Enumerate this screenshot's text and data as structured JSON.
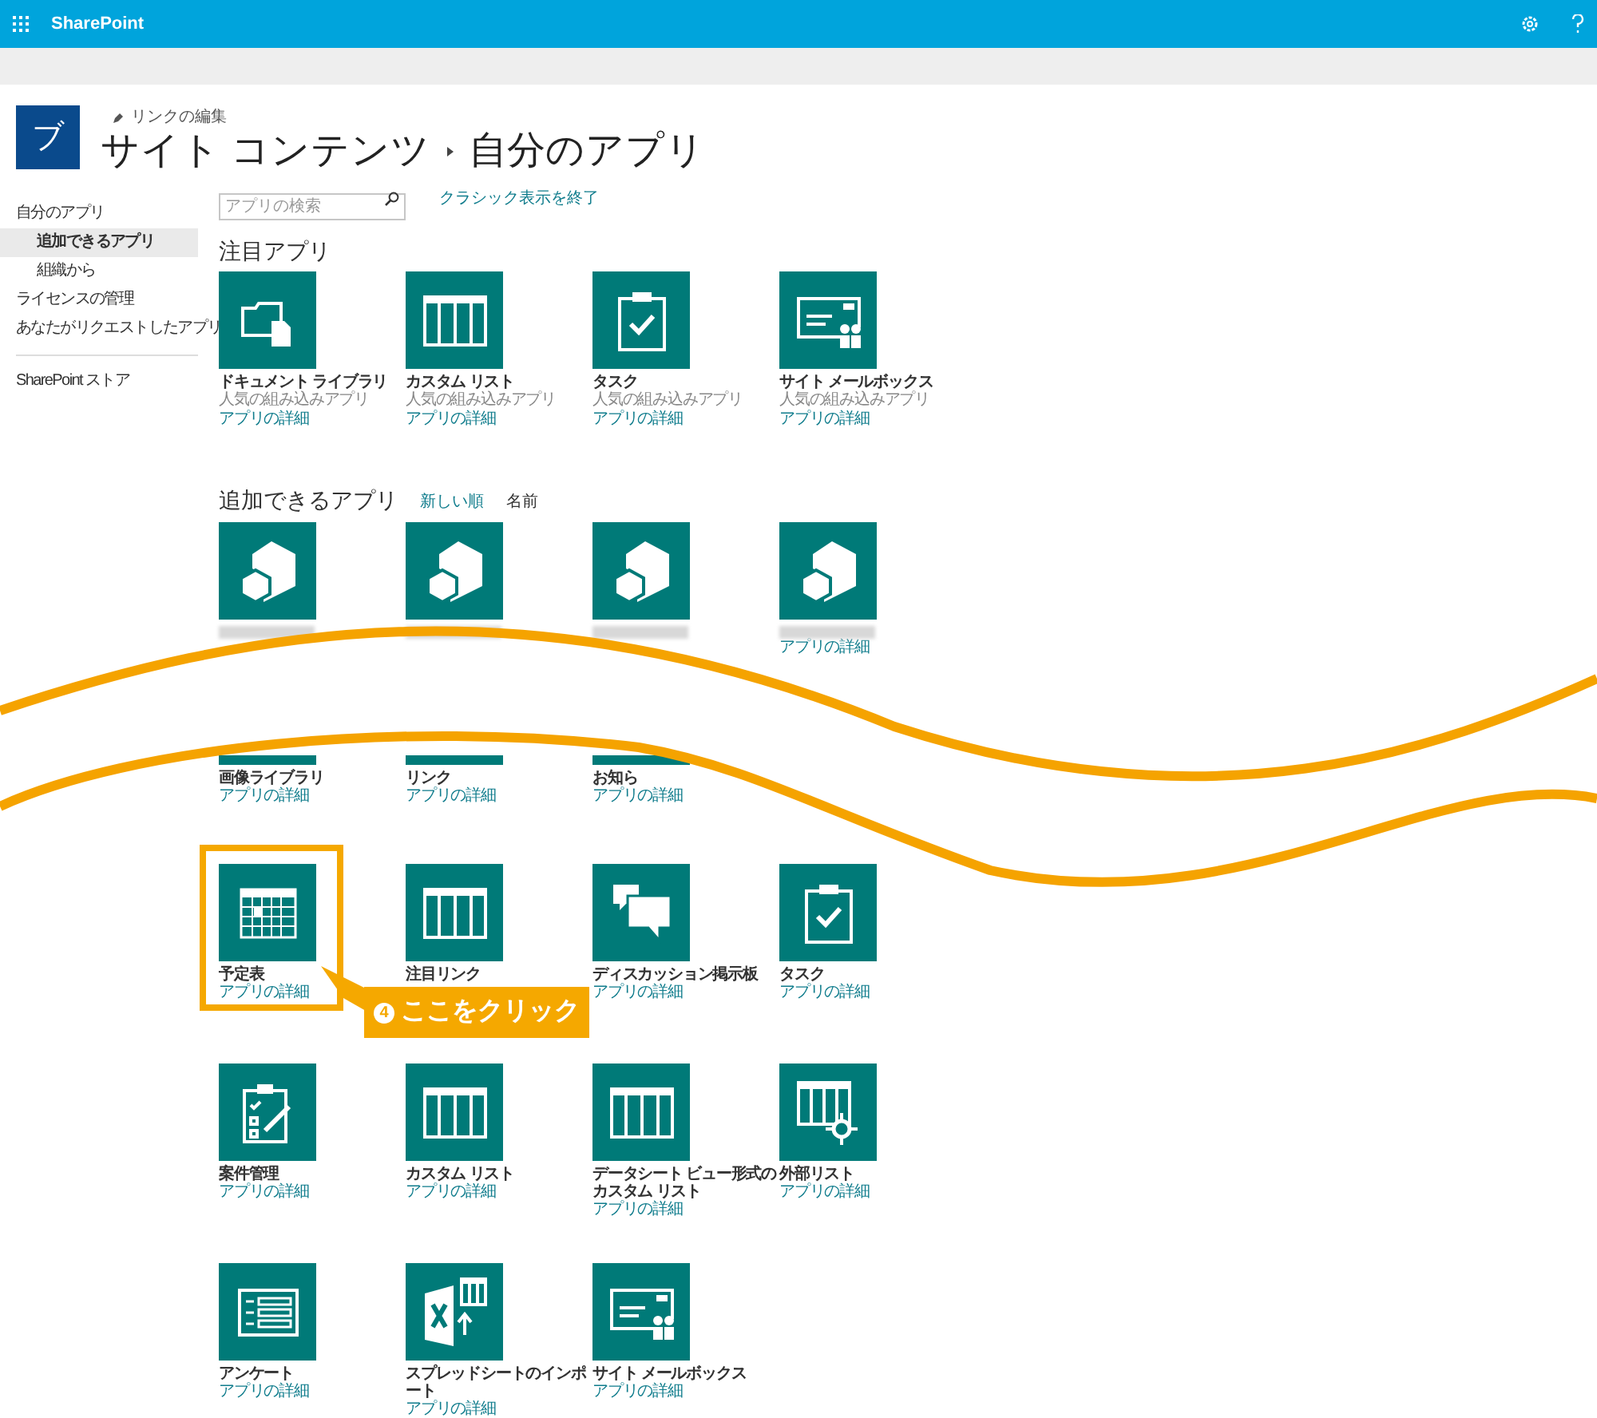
{
  "top_bar": {
    "title": "SharePoint"
  },
  "site": {
    "logo_letter": "ブ",
    "edit_links": "リンクの編集",
    "breadcrumb": [
      "サイト コンテンツ",
      "自分のアプリ"
    ]
  },
  "sidebar": {
    "items": [
      {
        "label": "自分のアプリ",
        "selected": false,
        "children": [
          {
            "label": "追加できるアプリ",
            "selected": true
          },
          {
            "label": "組織から",
            "selected": false
          }
        ]
      },
      {
        "label": "ライセンスの管理",
        "selected": false
      },
      {
        "label": "あなたがリクエストしたアプリ",
        "selected": false
      }
    ],
    "footer_items": [
      {
        "label": "SharePoint ストア",
        "selected": false
      }
    ]
  },
  "search": {
    "placeholder": "アプリの検索"
  },
  "classic_link": "クラシック表示を終了",
  "featured": {
    "title": "注目アプリ",
    "apps": [
      {
        "kind": "folder",
        "name": "ドキュメント ライブラリ",
        "description": "人気の組み込みアプリ",
        "details": "アプリの詳細"
      },
      {
        "kind": "list",
        "name": "カスタム リスト",
        "description": "人気の組み込みアプリ",
        "details": "アプリの詳細"
      },
      {
        "kind": "task",
        "name": "タスク",
        "description": "人気の組み込みアプリ",
        "details": "アプリの詳細"
      },
      {
        "kind": "mailbox",
        "name": "サイト メールボックス",
        "description": "人気の組み込みアプリ",
        "details": "アプリの詳細"
      }
    ]
  },
  "available": {
    "title": "追加できるアプリ",
    "sort_options": [
      {
        "label": "新しい順",
        "selected": false
      },
      {
        "label": "名前",
        "selected": true
      }
    ],
    "apps_before_cut": [
      {
        "kind": "app",
        "blurred": true
      },
      {
        "kind": "app",
        "blurred": true
      },
      {
        "kind": "app",
        "blurred": true
      },
      {
        "kind": "app",
        "blurred": true,
        "details": "アプリの詳細"
      }
    ],
    "apps_after_cut": [
      {
        "kind": "partial",
        "name": "画像ライブラリ",
        "details": "アプリの詳細"
      },
      {
        "kind": "partial",
        "name": "リンク",
        "details": "アプリの詳細"
      },
      {
        "kind": "partial",
        "name": "お知ら",
        "details": "アプリの詳細"
      },
      {
        "kind": "none"
      },
      {
        "kind": "calendar",
        "name": "予定表",
        "details": "アプリの詳細",
        "highlighted": true,
        "callout": {
          "step": "4",
          "text": "ここをクリック"
        }
      },
      {
        "kind": "list",
        "name": "注目リンク"
      },
      {
        "kind": "discussion",
        "name": "ディスカッション掲示板",
        "details": "アプリの詳細"
      },
      {
        "kind": "task",
        "name": "タスク",
        "details": "アプリの詳細"
      },
      {
        "kind": "tracking",
        "name": "案件管理",
        "details": "アプリの詳細"
      },
      {
        "kind": "list",
        "name": "カスタム リスト",
        "details": "アプリの詳細"
      },
      {
        "kind": "list",
        "name": "データシート ビュー形式のカスタム リスト",
        "details": "アプリの詳細"
      },
      {
        "kind": "external",
        "name": "外部リスト",
        "details": "アプリの詳細"
      },
      {
        "kind": "survey",
        "name": "アンケート",
        "details": "アプリの詳細"
      },
      {
        "kind": "import",
        "name": "スプレッドシートのインポート",
        "details": "アプリの詳細"
      },
      {
        "kind": "mailbox",
        "name": "サイト メールボックス",
        "details": "アプリの詳細"
      }
    ]
  }
}
